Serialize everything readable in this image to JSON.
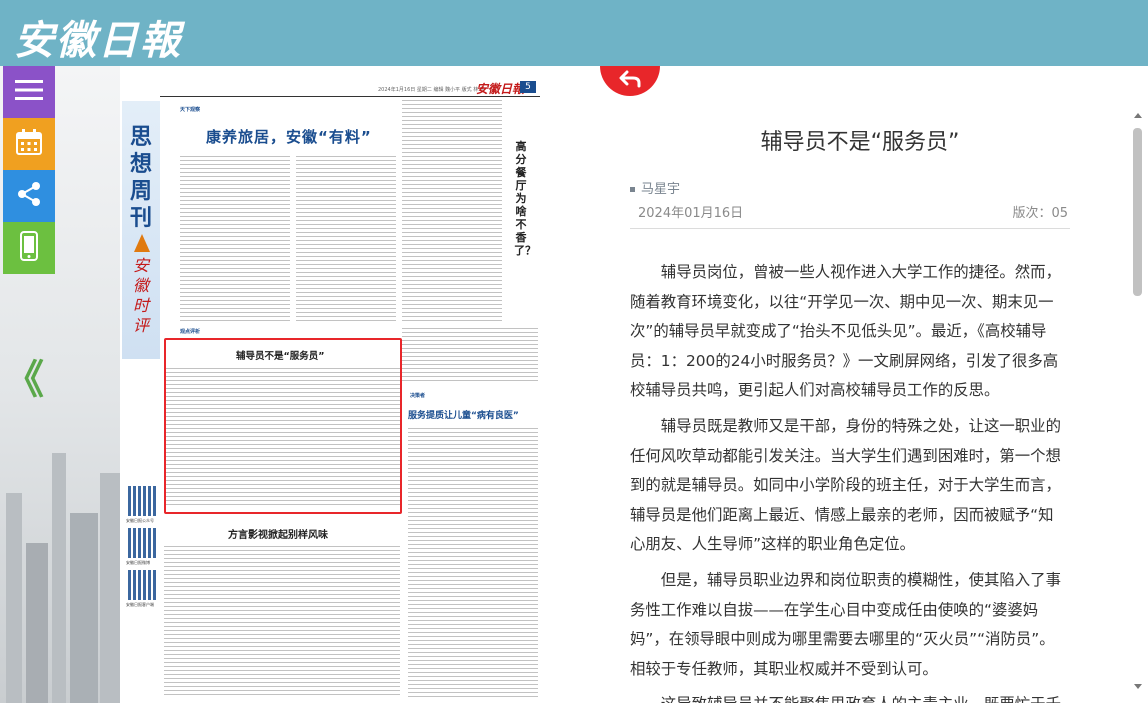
{
  "header": {
    "logo_text": "安徽日報"
  },
  "toolbar": {
    "menu_icon": "menu-icon",
    "calendar_icon": "calendar-icon",
    "share_icon": "share-icon",
    "mobile_icon": "mobile-icon",
    "collapse_label": "《"
  },
  "newspaper": {
    "date_line": "2024年1月16日 星期二  编辑 魏小平  版式 林 冬",
    "brand": "安徽日報",
    "page_number": "5",
    "section_title": "思想周刊",
    "section_brand": "安徽时评",
    "tag_top": "天下观察",
    "headline_main": "康养旅居，安徽“有料”",
    "tag_mid": "观点评析",
    "headline_highlight": "辅导员不是“服务员”",
    "headline_dialect": "方言影视掀起别样风味",
    "tag_right": "决策者",
    "headline_clinic": "服务提质让儿童“病有良医”",
    "vertical_headline": "高分餐厅为啥不香了？",
    "qr_caption_1": "安徽日报公众号",
    "qr_caption_2": "安徽日报微博",
    "qr_caption_3": "安徽日报客户端"
  },
  "article": {
    "title": "辅导员不是“服务员”",
    "author": "马星宇",
    "date": "2024年01月16日",
    "edition": "版次：05",
    "paragraphs": [
      "辅导员岗位，曾被一些人视作进入大学工作的捷径。然而，随着教育环境变化，以往“开学见一次、期中见一次、期末见一次”的辅导员早就变成了“抬头不见低头见”。最近，《高校辅导员：1：200的24小时服务员？》一文刷屏网络，引发了很多高校辅导员共鸣，更引起人们对高校辅导员工作的反思。",
      "辅导员既是教师又是干部，身份的特殊之处，让这一职业的任何风吹草动都能引发关注。当大学生们遇到困难时，第一个想到的就是辅导员。如同中小学阶段的班主任，对于大学生而言，辅导员是他们距离上最近、情感上最亲的老师，因而被赋予“知心朋友、人生导师”这样的职业角色定位。",
      "但是，辅导员职业边界和岗位职责的模糊性，使其陷入了事务性工作难以自拔——在学生心目中变成任由使唤的“婆婆妈妈”，在领导眼中则成为哪里需要去哪里的“灭火员”“消防员”。相较于专任教师，其职业权威并不受到认可。",
      "这导致辅导员并不能聚焦思政育人的主责主业，既要忙于千"
    ]
  },
  "colors": {
    "header_bg": "#6fb3c6",
    "accent_red": "#e8262a",
    "menu_purple": "#8b52c8",
    "calendar_orange": "#f0a020",
    "share_blue": "#2f8fe0",
    "mobile_green": "#6cc040"
  }
}
